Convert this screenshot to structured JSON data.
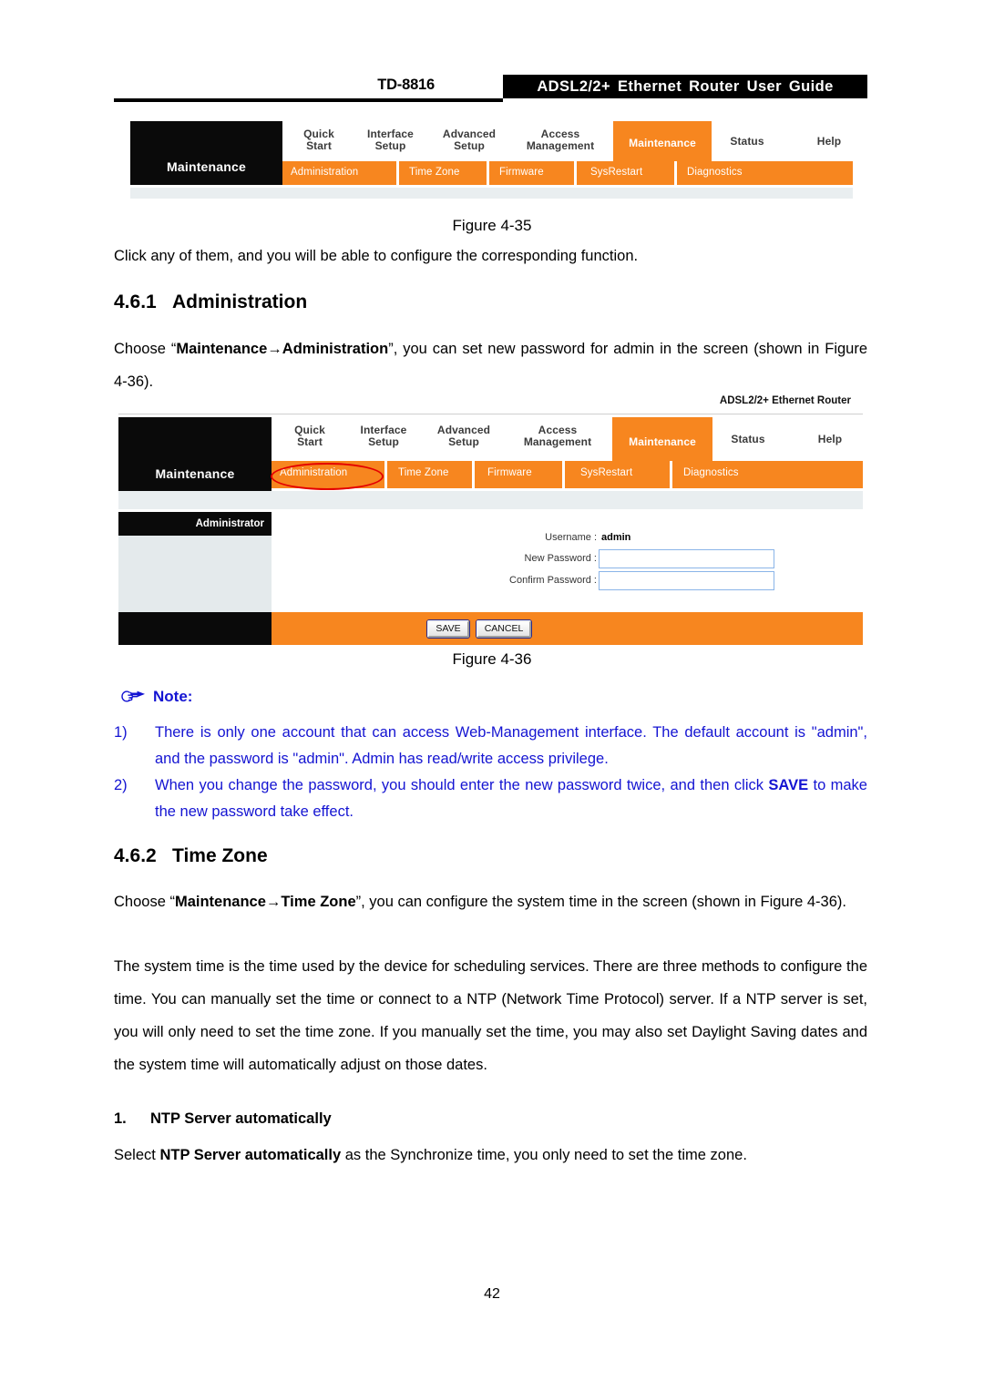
{
  "header": {
    "model": "TD-8816",
    "title": "ADSL2/2+ Ethernet Router User Guide"
  },
  "figure1": {
    "logo_label": "Maintenance",
    "main_tabs": [
      {
        "label": "Quick\nStart",
        "line1": "Quick",
        "line2": "Start",
        "active": false
      },
      {
        "label": "Interface\nSetup",
        "line1": "Interface",
        "line2": "Setup",
        "active": false
      },
      {
        "label": "Advanced\nSetup",
        "line1": "Advanced",
        "line2": "Setup",
        "active": false
      },
      {
        "label": "Access\nManagement",
        "line1": "Access",
        "line2": "Management",
        "active": false
      },
      {
        "label": "Maintenance",
        "line1": "Maintenance",
        "line2": "",
        "active": true
      },
      {
        "label": "Status",
        "line1": "Status",
        "line2": "",
        "active": false
      },
      {
        "label": "Help",
        "line1": "Help",
        "line2": "",
        "active": false
      }
    ],
    "sub_tabs": [
      "Administration",
      "Time Zone",
      "Firmware",
      "SysRestart",
      "Diagnostics"
    ],
    "caption": "Figure 4-35"
  },
  "para1": "Click any of them, and you will be able to configure the corresponding function.",
  "section_461": {
    "number": "4.6.1",
    "title": "Administration"
  },
  "para2": {
    "pre": "Choose “",
    "bold1": "Maintenance",
    "arrow": "→",
    "bold2": "Administration",
    "post": "”, you can set new password for admin in the screen (shown in Figure 4-36)."
  },
  "figure2": {
    "brand": "ADSL2/2+ Ethernet Router",
    "logo_label": "Maintenance",
    "main_tabs": [
      {
        "line1": "Quick",
        "line2": "Start",
        "active": false
      },
      {
        "line1": "Interface",
        "line2": "Setup",
        "active": false
      },
      {
        "line1": "Advanced",
        "line2": "Setup",
        "active": false
      },
      {
        "line1": "Access",
        "line2": "Management",
        "active": false
      },
      {
        "line1": "Maintenance",
        "line2": "",
        "active": true
      },
      {
        "line1": "Status",
        "line2": "",
        "active": false
      },
      {
        "line1": "Help",
        "line2": "",
        "active": false
      }
    ],
    "sub_tabs": [
      "Administration",
      "Time Zone",
      "Firmware",
      "SysRestart",
      "Diagnostics"
    ],
    "highlighted_sub_tab": "Administration",
    "section_header": "Administrator",
    "fields": [
      {
        "label": "Username :",
        "value": "admin",
        "type": "text"
      },
      {
        "label": "New Password :",
        "value": "",
        "type": "input"
      },
      {
        "label": "Confirm Password :",
        "value": "",
        "type": "input"
      }
    ],
    "buttons": [
      "SAVE",
      "CANCEL"
    ],
    "caption": "Figure 4-36"
  },
  "note": {
    "heading": "Note:",
    "items": [
      {
        "marker": "1)",
        "text": "There is only one account that can access Web-Management interface. The default account is \"admin\", and the password is \"admin\". Admin has read/write access privilege."
      },
      {
        "marker": "2)",
        "text_pre": "When you change the password, you should enter the new password twice, and then click ",
        "bold": "SAVE",
        "text_post": " to make the new password take effect."
      }
    ]
  },
  "section_462": {
    "number": "4.6.2",
    "title": "Time Zone"
  },
  "para3": {
    "pre": "Choose “",
    "bold1": "Maintenance",
    "arrow": "→",
    "bold2": "Time Zone",
    "post": "”, you can configure the system time in the screen (shown in Figure 4-36)."
  },
  "para4": "The system time is the time used by the device for scheduling services. There are three methods to configure the time. You can manually set the time or connect to a NTP (Network Time Protocol) server. If a NTP server is set, you will only need to set the time zone. If you manually set the time, you may also set Daylight Saving dates and the system time will automatically adjust on those dates.",
  "subsection_1": {
    "number": "1.",
    "title": "NTP Server automatically"
  },
  "para5": {
    "pre": "Select ",
    "bold": "NTP Server automatically",
    "post": " as the Synchronize time, you only need to set the time zone."
  },
  "page_number": "42",
  "colors": {
    "accent_orange": "#f7861f",
    "black": "#0a0a0a",
    "note_blue": "#1414d2",
    "highlight_red": "#e40000",
    "input_border": "#8ab4e8",
    "panel_grey": "#e4eaec"
  }
}
